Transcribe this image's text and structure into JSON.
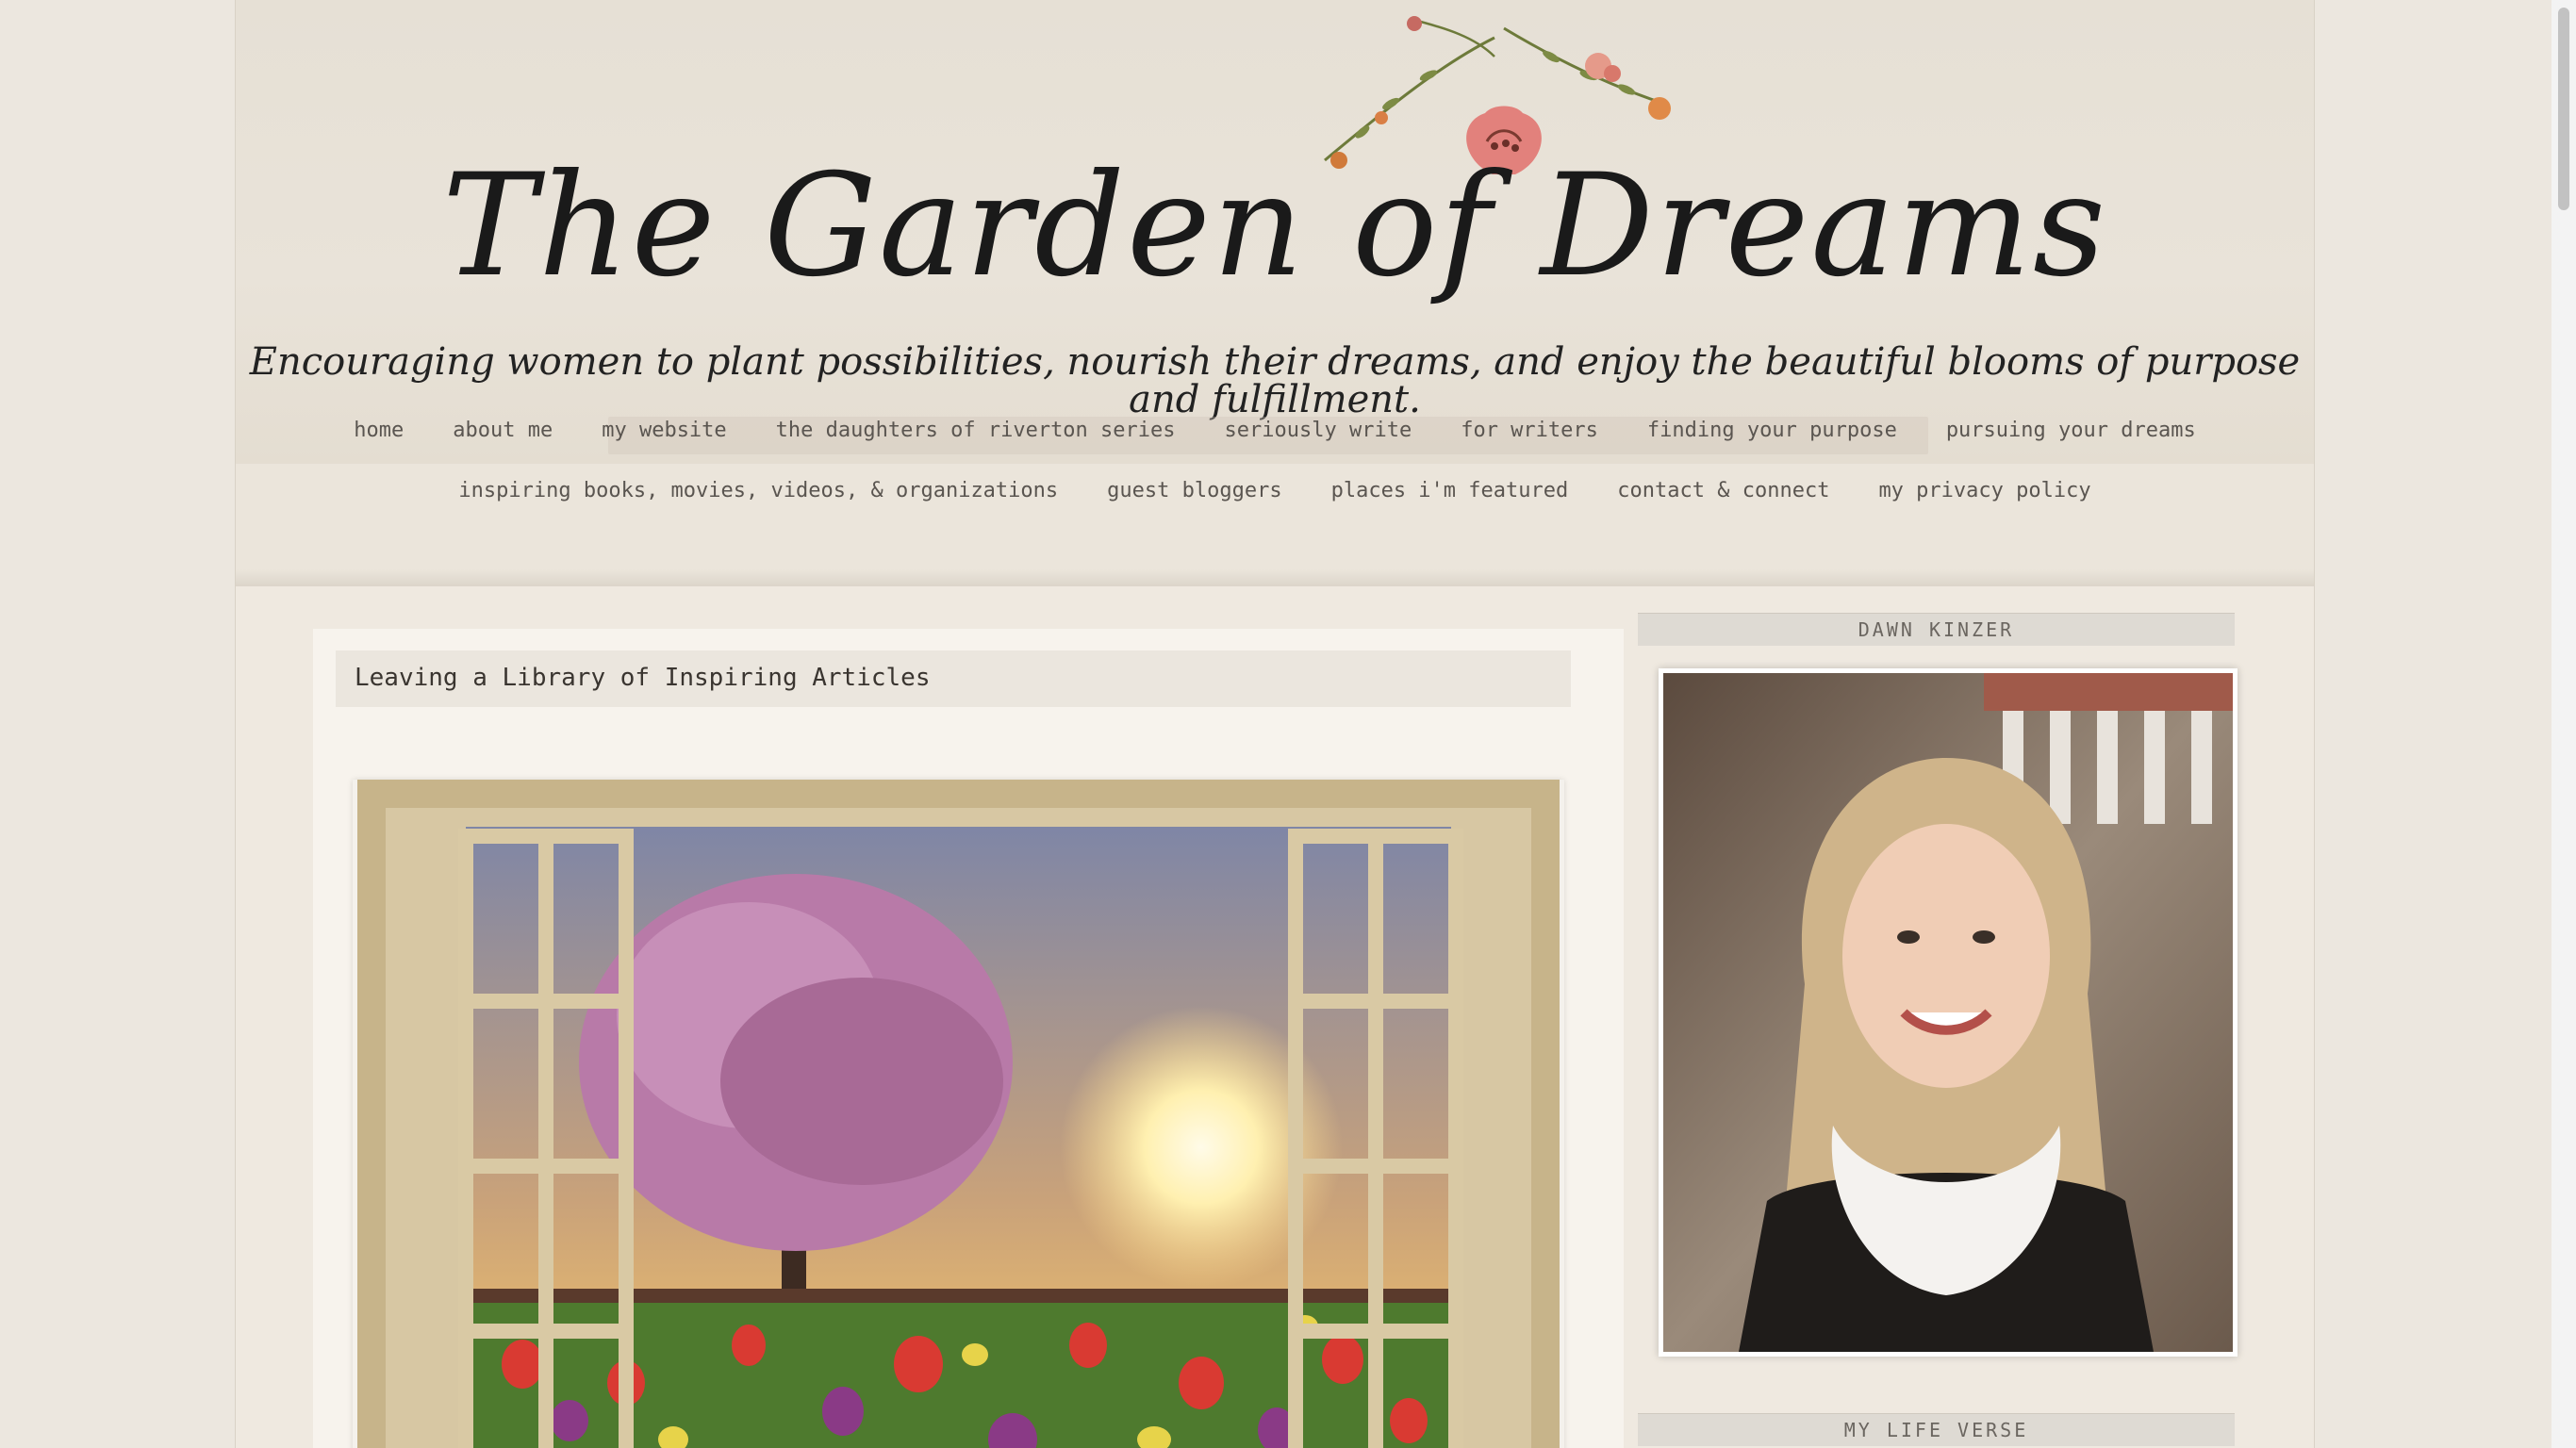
{
  "site": {
    "title": "The Garden of Dreams",
    "tagline": "Encouraging women to plant possibilities, nourish their dreams, and enjoy the beautiful blooms of purpose and fulfillment."
  },
  "nav": {
    "row1": [
      "home",
      "about me",
      "my website",
      "the daughters of riverton series",
      "seriously write",
      "for writers",
      "finding your purpose",
      "pursuing your dreams"
    ],
    "row2": [
      "inspiring books, movies, videos, & organizations",
      "guest bloggers",
      "places i'm featured",
      "contact & connect",
      "my privacy policy"
    ]
  },
  "post": {
    "title": "Leaving a Library of Inspiring Articles"
  },
  "sidebar": {
    "author_widget_title": "DAWN KINZER",
    "verse_widget_title": "MY LIFE VERSE"
  }
}
